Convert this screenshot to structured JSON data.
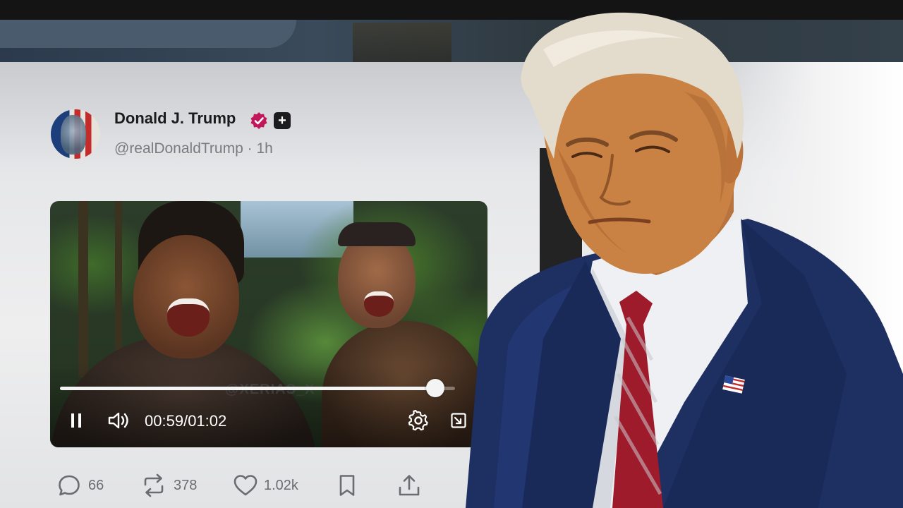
{
  "tweet": {
    "display_name": "Donald J. Trump",
    "handle": "@realDonaldTrump",
    "separator": "·",
    "time_ago": "1h",
    "icons": {
      "avatar": "flag-portrait-avatar",
      "verified": "verified-badge-icon",
      "plus": "plus-icon"
    },
    "accent_colors": {
      "verified": "#c2185b",
      "text": "#1b1b1b",
      "muted": "#7a7b80"
    }
  },
  "video": {
    "watermark": "@XERIAS_X",
    "current_time": "00:59",
    "time_separator": "/",
    "duration": "01:02",
    "progress_fraction": 0.95,
    "playing": true,
    "controls": [
      "pause-icon",
      "volume-icon",
      "settings-icon",
      "minimize-icon"
    ]
  },
  "actions": [
    {
      "name": "reply",
      "icon": "reply-icon",
      "count": "66"
    },
    {
      "name": "repost",
      "icon": "repost-icon",
      "count": "378"
    },
    {
      "name": "like",
      "icon": "heart-icon",
      "count": "1.02k"
    },
    {
      "name": "bookmark",
      "icon": "bookmark-icon",
      "count": ""
    },
    {
      "name": "share",
      "icon": "share-icon",
      "count": ""
    }
  ]
}
